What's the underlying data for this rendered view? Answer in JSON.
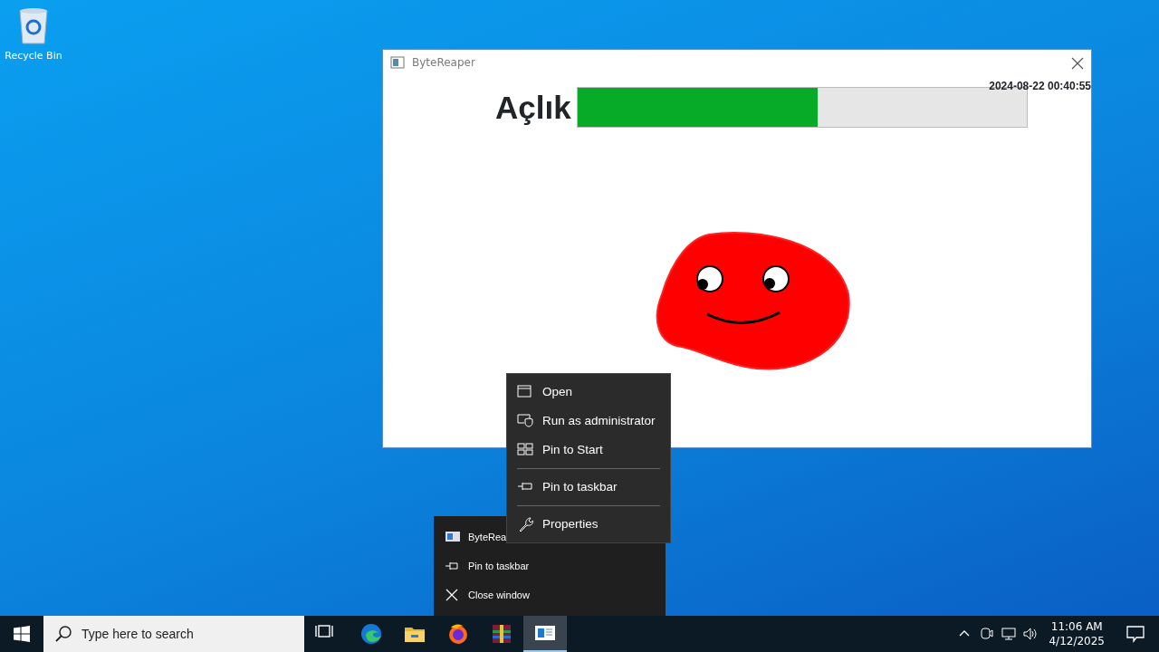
{
  "desktop": {
    "icons": [
      {
        "label": "Recycle Bin"
      }
    ]
  },
  "window": {
    "title": "ByteReaper",
    "timestamp": "2024-08-22 00:40:55",
    "meter": {
      "label": "Açlık",
      "level": 0.535
    }
  },
  "context_menu": {
    "items": [
      {
        "kind": "item",
        "label": "Open"
      },
      {
        "kind": "item",
        "label": "Run as administrator"
      },
      {
        "kind": "item",
        "label": "Pin to Start"
      },
      {
        "kind": "separator"
      },
      {
        "kind": "item",
        "label": "Pin to taskbar"
      },
      {
        "kind": "separator"
      },
      {
        "kind": "item",
        "label": "Properties"
      }
    ]
  },
  "jump_list": {
    "items": [
      {
        "label": "ByteRea"
      },
      {
        "label": "Pin to taskbar"
      },
      {
        "label": "Close window"
      }
    ]
  },
  "taskbar": {
    "search": {
      "placeholder": "Type here to search"
    },
    "apps": [
      {
        "selected": false
      },
      {
        "selected": false
      },
      {
        "selected": false
      },
      {
        "selected": false
      },
      {
        "selected": false
      },
      {
        "selected": true
      }
    ],
    "clock": {
      "time": "11:06 AM",
      "date": "4/12/2025"
    }
  }
}
